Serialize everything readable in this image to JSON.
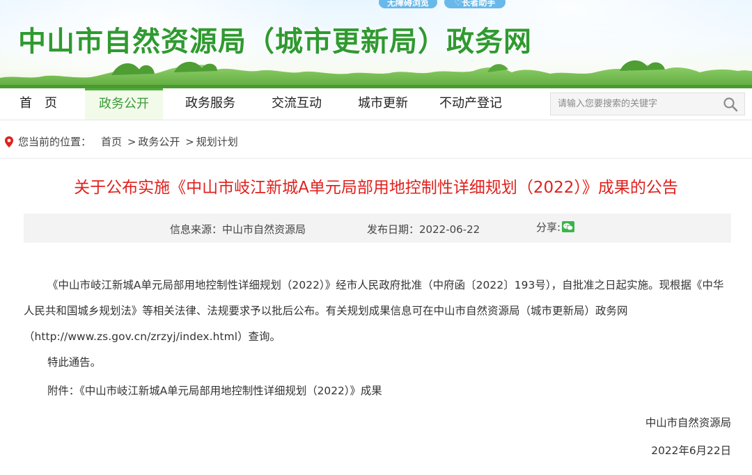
{
  "header": {
    "top_links": [
      "无障碍浏览",
      "长者助手"
    ],
    "site_title": "中山市自然资源局（城市更新局）政务网"
  },
  "nav": {
    "items": [
      {
        "label": "首　页",
        "active": false
      },
      {
        "label": "政务公开",
        "active": true
      },
      {
        "label": "政务服务",
        "active": false
      },
      {
        "label": "交流互动",
        "active": false
      },
      {
        "label": "城市更新",
        "active": false
      },
      {
        "label": "不动产登记",
        "active": false
      }
    ],
    "search_placeholder": "请输入您要搜索的关键字"
  },
  "breadcrumb": {
    "prefix": "您当前的位置：",
    "items": [
      "首页",
      "政务公开",
      "规划计划"
    ],
    "separator": ">"
  },
  "article": {
    "title": "关于公布实施《中山市岐江新城A单元局部用地控制性详细规划（2022）》成果的公告",
    "meta": {
      "source_label": "信息来源：",
      "source": "中山市自然资源局",
      "date_label": "发布日期：",
      "date": "2022-06-22",
      "share_label": "分享:"
    },
    "paragraph": "《中山市岐江新城A单元局部用地控制性详细规划（2022）》经市人民政府批准（中府函〔2022〕193号），自批准之日起实施。现根据《中华人民共和国城乡规划法》等相关法律、法规要求予以批后公布。有关规划成果信息可在中山市自然资源局（城市更新局）政务网（http://www.zs.gov.cn/zrzyj/index.html）查询。",
    "notice": "特此通告。",
    "attachment_label": "附件：",
    "attachment": "《中山市岐江新城A单元局部用地控制性详细规划（2022）》成果",
    "signature_org": "中山市自然资源局",
    "signature_date": "2022年6月22日"
  },
  "colors": {
    "title_green": "#2f9a30",
    "article_title_red": "#e0211d",
    "active_nav_green": "#3a9a35",
    "top_pill_blue": "#69b8ea"
  },
  "icons": [
    "location-pin-icon",
    "search-icon",
    "wechat-icon",
    "accessibility-icon",
    "elder-assist-icon"
  ]
}
